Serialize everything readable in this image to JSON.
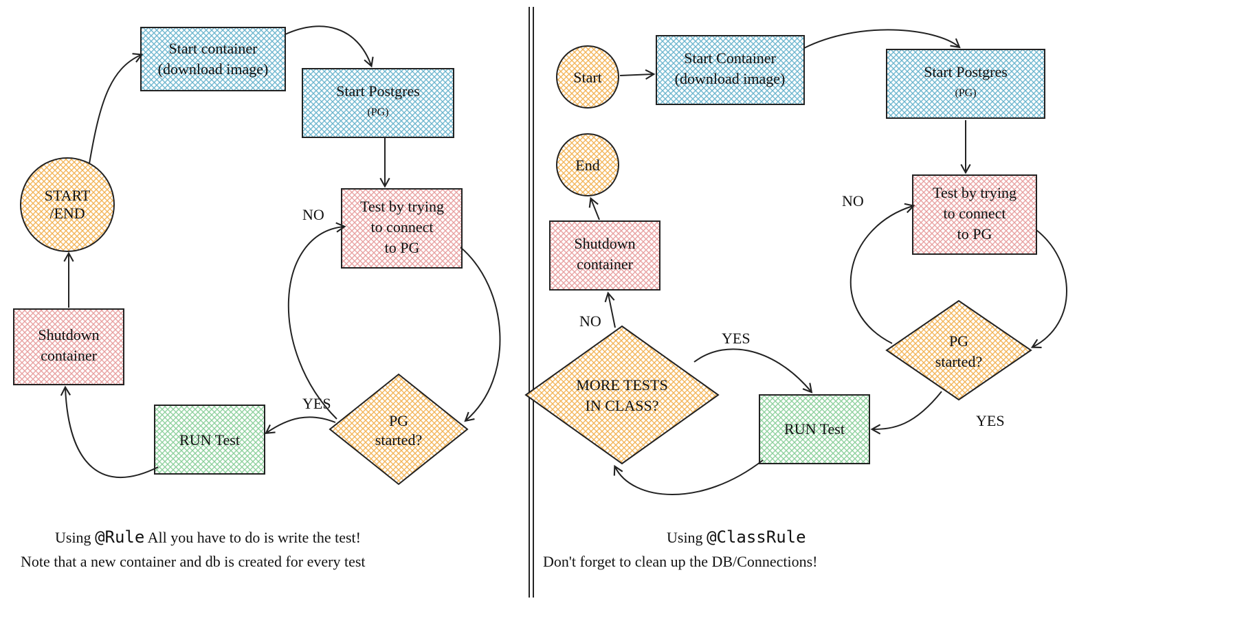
{
  "left": {
    "startEnd1": "START",
    "startEnd2": "/END",
    "startContainer1": "Start container",
    "startContainer2": "(download image)",
    "startPg1": "Start Postgres",
    "startPg2": "(PG)",
    "test1": "Test by trying",
    "test2": "to connect",
    "test3": "to PG",
    "decision1": "PG",
    "decision2": "started?",
    "yes": "YES",
    "no": "NO",
    "run": "RUN Test",
    "shutdown1": "Shutdown",
    "shutdown2": "container",
    "caption1a": "Using ",
    "caption1b": "@Rule",
    "caption1c": " All you have to do is write the test!",
    "caption2": "Note that a new container and db is created for every test"
  },
  "right": {
    "start": "Start",
    "end": "End",
    "startContainer1": "Start Container",
    "startContainer2": "(download image)",
    "startPg1": "Start Postgres",
    "startPg2": "(PG)",
    "test1": "Test by trying",
    "test2": "to connect",
    "test3": "to PG",
    "pgDec1": "PG",
    "pgDec2": "started?",
    "pgYes": "YES",
    "pgNo": "NO",
    "run": "RUN Test",
    "moreDec1": "MORE TESTS",
    "moreDec2": "IN CLASS?",
    "moreYes": "YES",
    "moreNo": "NO",
    "shutdown1": "Shutdown",
    "shutdown2": "container",
    "caption1a": "Using   ",
    "caption1b": "@ClassRule",
    "caption2": "Don't forget to clean up the DB/Connections!"
  },
  "colors": {
    "orange": "#f3b55a",
    "blue": "#6fb7cf",
    "pink": "#e8a2a2",
    "green": "#8fd19e",
    "stroke": "#222"
  }
}
